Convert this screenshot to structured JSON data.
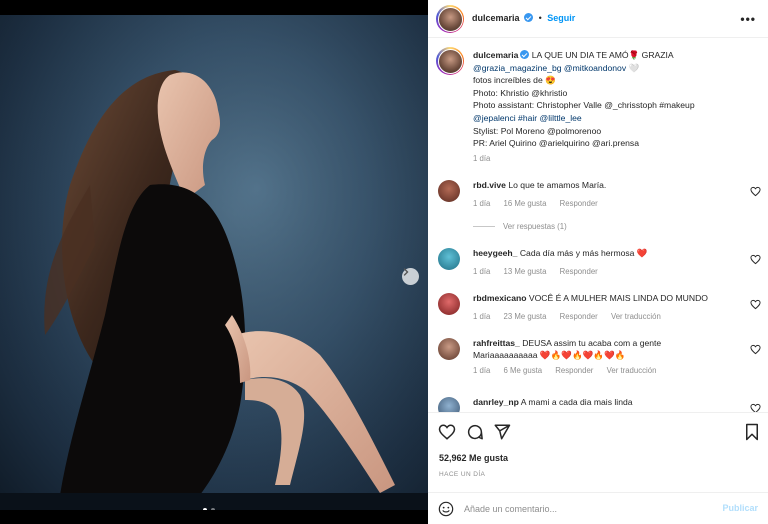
{
  "post": {
    "username": "dulcemaria",
    "follow_label": "Seguir",
    "more_label": "•••"
  },
  "caption": {
    "username": "dulcemaria",
    "lines": [
      "LA QUE UN DIA TE AMÓ🌹 GRAZIA",
      "@grazia_magazine_bg @mitkoandonov 🤍",
      "fotos increíbles de 😍",
      "Photo: Khristio @khristio",
      "Photo assistant: Christopher Valle @_chrisstoph #makeup",
      "@jepalenci #hair @lilttle_lee",
      "Stylist: Pol Moreno @polmorenoo",
      "PR: Ariel Quirino @arielquirino @ari.prensa"
    ],
    "time": "1 día"
  },
  "comments": [
    {
      "user": "rbd.vive",
      "text": "Lo que te amamos María.",
      "time": "1 día",
      "likes": "16 Me gusta",
      "reply": "Responder",
      "translate": "",
      "avatar_color": "#7a3b2e"
    },
    {
      "user": "heeygeeh_",
      "text": "Cada día más y más hermosa ❤️",
      "time": "1 día",
      "likes": "13 Me gusta",
      "reply": "Responder",
      "translate": "",
      "avatar_color": "#2f8fa8"
    },
    {
      "user": "rbdmexicano",
      "text": "VOCÊ É A MULHER MAIS LINDA DO MUNDO",
      "time": "1 día",
      "likes": "23 Me gusta",
      "reply": "Responder",
      "translate": "Ver traducción",
      "avatar_color": "#b03a3a"
    },
    {
      "user": "rahfreittas_",
      "text": "DEUSA assim tu acaba com a gente",
      "text2": "Mariaaaaaaaaaa ❤️🔥❤️🔥❤️🔥❤️🔥",
      "time": "1 día",
      "likes": "6 Me gusta",
      "reply": "Responder",
      "translate": "Ver traducción",
      "avatar_color": "#8c5a48"
    },
    {
      "user": "danrley_np",
      "text": "A mami a cada dia mais linda",
      "avatar_color": "#5d7a9a"
    }
  ],
  "replies_label": "Ver respuestas (1)",
  "likes_count": "52,962 Me gusta",
  "posted_ago": "HACE UN DÍA",
  "add_comment": {
    "placeholder": "Añade un comentario...",
    "post_label": "Publicar"
  },
  "carousel": {
    "total": 2,
    "active": 1
  },
  "colors": {
    "link": "#00376b",
    "accent": "#0095f6",
    "muted": "#8e8e8e"
  },
  "icons": [
    "more-icon",
    "verified-icon",
    "heart-icon",
    "comment-icon",
    "share-icon",
    "bookmark-icon",
    "emoji-icon",
    "chevron-right-icon"
  ]
}
